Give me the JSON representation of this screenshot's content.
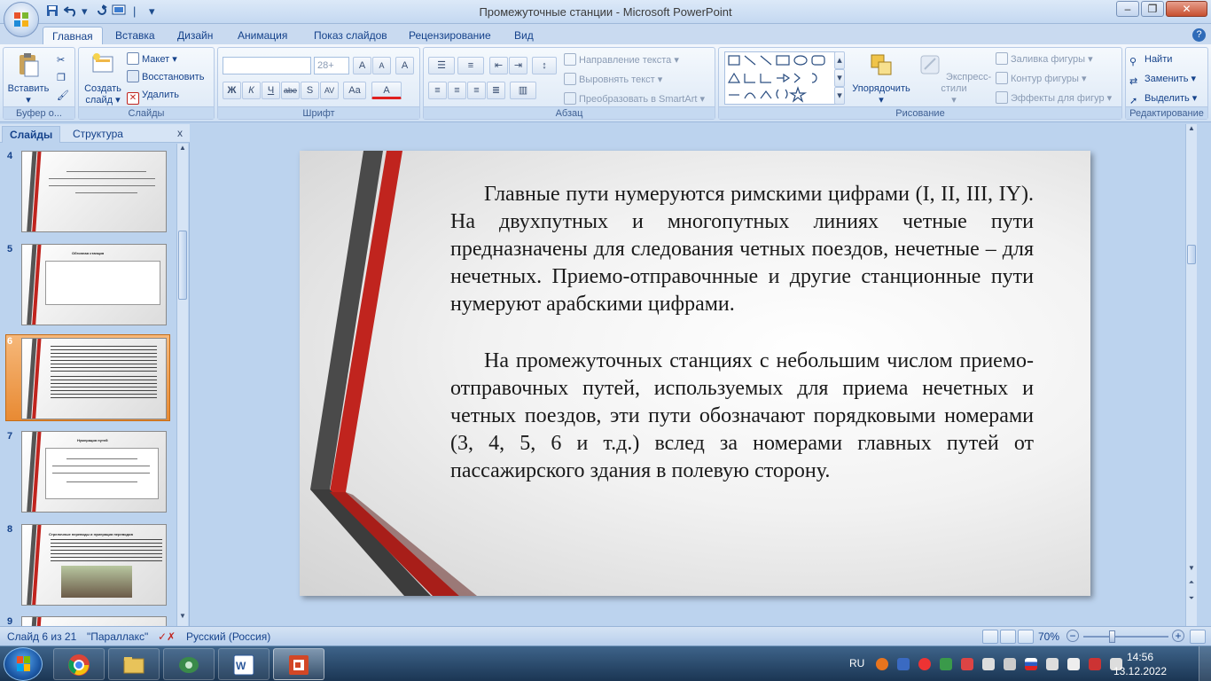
{
  "window": {
    "title": "Промежуточные станции - Microsoft PowerPoint",
    "minimize": "–",
    "restore": "❐",
    "close": "✕"
  },
  "ribbon_tabs": [
    "Главная",
    "Вставка",
    "Дизайн",
    "Анимация",
    "Показ слайдов",
    "Рецензирование",
    "Вид"
  ],
  "help": "?",
  "ribbon": {
    "clipboard": {
      "label": "Буфер о...",
      "paste": "Вставить"
    },
    "slides": {
      "label": "Слайды",
      "new_slide_1": "Создать",
      "new_slide_2": "слайд",
      "layout": "Макет",
      "reset": "Восстановить",
      "delete": "Удалить"
    },
    "font": {
      "label": "Шрифт",
      "font_size": "28+",
      "bold": "Ж",
      "italic": "К",
      "underline": "Ч",
      "strike": "abe",
      "shadow": "S",
      "spacing": "AV",
      "case": "Aa",
      "color": "A",
      "grow": "A",
      "shrink": "A",
      "clear": "A"
    },
    "paragraph": {
      "label": "Абзац",
      "text_direction": "Направление текста",
      "align_text": "Выровнять текст",
      "smartart": "Преобразовать в SmartArt"
    },
    "drawing": {
      "label": "Рисование",
      "arrange": "Упорядочить",
      "quick_styles": "Экспресс-стили",
      "shape_fill": "Заливка фигуры",
      "shape_outline": "Контур фигуры",
      "shape_effects": "Эффекты для фигур"
    },
    "editing": {
      "label": "Редактирование",
      "find": "Найти",
      "replace": "Заменить",
      "select": "Выделить"
    }
  },
  "panel": {
    "tab_slides": "Слайды",
    "tab_outline": "Структура",
    "close": "x",
    "thumbs": [
      {
        "num": "4"
      },
      {
        "num": "5",
        "title": "Обгонная станция"
      },
      {
        "num": "6"
      },
      {
        "num": "7",
        "title": "Нумерация путей"
      },
      {
        "num": "8",
        "title": "Стрелочные переводы и нумерация переводов"
      },
      {
        "num": "9"
      }
    ]
  },
  "slide": {
    "para1": "Главные пути нумеруются римскими цифрами (I, II, III, IY). На двухпутных и многопутных линиях четные пути предназначены для следования четных поездов, нечетные – для нечетных. Приемо-отправочнные и другие станционные пути нумеруют арабскими цифрами.",
    "para2": "На промежуточных станциях с небольшим числом приемо-отправочных путей, используемых для приема нечетных и четных поездов, эти пути обозначают порядковыми номерами (3, 4, 5, 6 и т.д.) вслед за номерами главных путей от пассажирского здания в полевую сторону."
  },
  "status": {
    "slide_counter": "Слайд 6 из 21",
    "theme": "\"Параллакс\"",
    "language": "Русский (Россия)",
    "zoom": "70%",
    "zoom_value": 0.7
  },
  "taskbar": {
    "lang": "RU",
    "time": "14:56",
    "date": "13.12.2022"
  },
  "colors": {
    "stripe_red": "#c0241e",
    "stripe_dark": "#4a4a4a",
    "selected_thumb": "#e88a33",
    "ribbon_text": "#15428b"
  }
}
